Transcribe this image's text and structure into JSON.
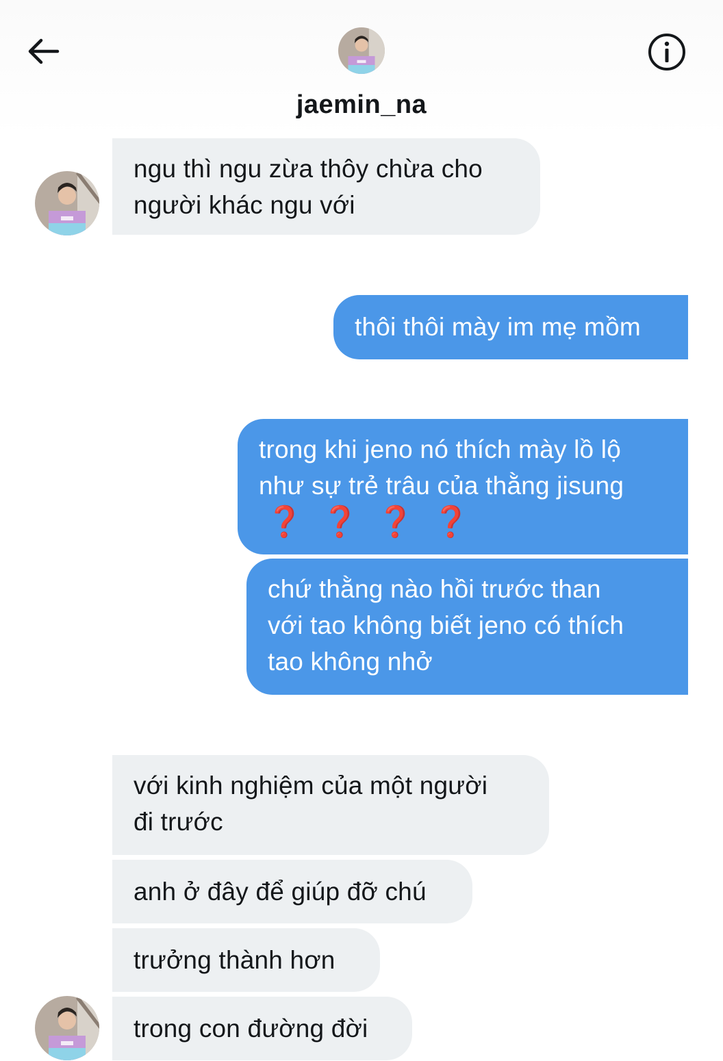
{
  "header": {
    "username": "jaemin_na",
    "back_icon": "arrow-left-icon",
    "info_icon": "info-circle-icon"
  },
  "messages": [
    {
      "from": "contact",
      "lines": [
        "ngu thì ngu zừa thôy chừa cho",
        "người khác ngu với"
      ]
    },
    {
      "from": "me",
      "lines": [
        "thôi thôi mày im mẹ mồm"
      ]
    },
    {
      "from": "me",
      "lines": [
        "trong khi jeno nó thích mày lồ lộ",
        "như sự trẻ trâu của thằng jisung"
      ],
      "emoji": [
        "❓",
        "❓",
        "❓",
        "❓"
      ]
    },
    {
      "from": "me",
      "lines": [
        "chứ thằng nào hồi trước than",
        "với tao không biết jeno có thích",
        "tao không nhở"
      ]
    },
    {
      "from": "contact",
      "lines": [
        "với kinh nghiệm của một người",
        "đi trước"
      ]
    },
    {
      "from": "contact",
      "lines": [
        "anh ở đây để giúp đỡ chú"
      ]
    },
    {
      "from": "contact",
      "lines": [
        "trưởng thành hơn"
      ]
    },
    {
      "from": "contact",
      "lines": [
        "trong con đường đời"
      ]
    }
  ],
  "colors": {
    "outgoing_bubble": "#4b97e8",
    "incoming_bubble": "#edf0f2",
    "text": "#14171a",
    "question_mark": "#cc2d2d"
  }
}
